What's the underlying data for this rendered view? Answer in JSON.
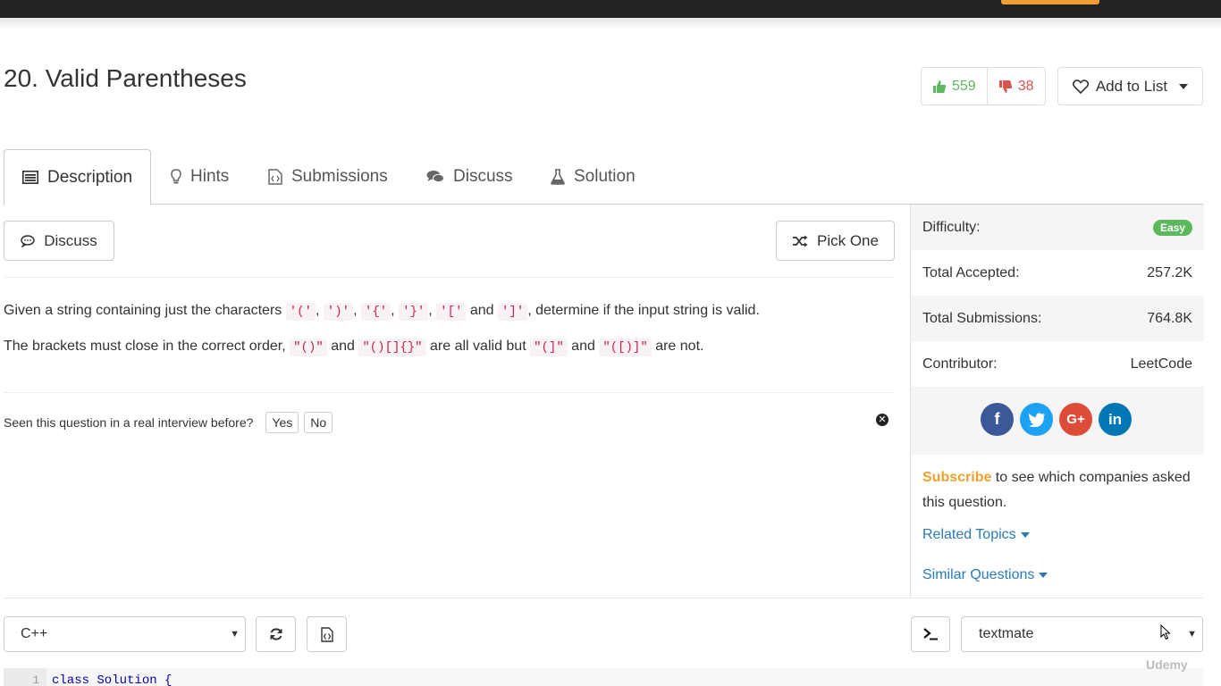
{
  "problem": {
    "title": "20. Valid Parentheses"
  },
  "votes": {
    "up": "559",
    "down": "38"
  },
  "add_to_list": "Add to List",
  "tabs": [
    {
      "label": "Description",
      "icon": "list-icon"
    },
    {
      "label": "Hints",
      "icon": "lightbulb-icon"
    },
    {
      "label": "Submissions",
      "icon": "file-code-icon"
    },
    {
      "label": "Discuss",
      "icon": "comments-icon"
    },
    {
      "label": "Solution",
      "icon": "flask-icon"
    }
  ],
  "actions": {
    "discuss": "Discuss",
    "pick_one": "Pick One"
  },
  "description": {
    "line1": {
      "before": "Given a string containing just the characters",
      "chars": [
        "'('",
        "')'",
        "'{'",
        "'}'",
        "'['",
        "']'"
      ],
      "and": "and",
      "after": ", determine if the input string is valid."
    },
    "line2": {
      "before": "The brackets must close in the correct order,",
      "ex1": "\"()\"",
      "and1": "and",
      "ex2": "\"()[]{}\"",
      "mid": "are all valid but",
      "ex3": "\"(]\"",
      "and2": "and",
      "ex4": "\"([)]\"",
      "after": "are not."
    }
  },
  "interview": {
    "question": "Seen this question in a real interview before?",
    "yes": "Yes",
    "no": "No"
  },
  "sidebar": {
    "difficulty_label": "Difficulty:",
    "difficulty_value": "Easy",
    "accepted_label": "Total Accepted:",
    "accepted_value": "257.2K",
    "submissions_label": "Total Submissions:",
    "submissions_value": "764.8K",
    "contributor_label": "Contributor:",
    "contributor_value": "LeetCode",
    "social": [
      "facebook-icon",
      "twitter-icon",
      "google-plus-icon",
      "linkedin-icon"
    ],
    "subscribe": "Subscribe",
    "subscribe_rest": " to see which companies asked this question.",
    "related_topics": "Related Topics",
    "similar_questions": "Similar Questions"
  },
  "editor_bar": {
    "language": "C++",
    "theme": "textmate"
  },
  "editor": {
    "line_number": "1",
    "first_line": "class Solution {"
  },
  "watermark": "Udemy",
  "colors": {
    "easy": "#5cb85c",
    "upvote": "#5cb85c",
    "downvote": "#d9534f",
    "link": "#2a7ab5",
    "subscribe": "#f0a030",
    "facebook": "#3b5998",
    "twitter": "#1da1f2",
    "google": "#dd4b39",
    "linkedin": "#0077b5"
  }
}
